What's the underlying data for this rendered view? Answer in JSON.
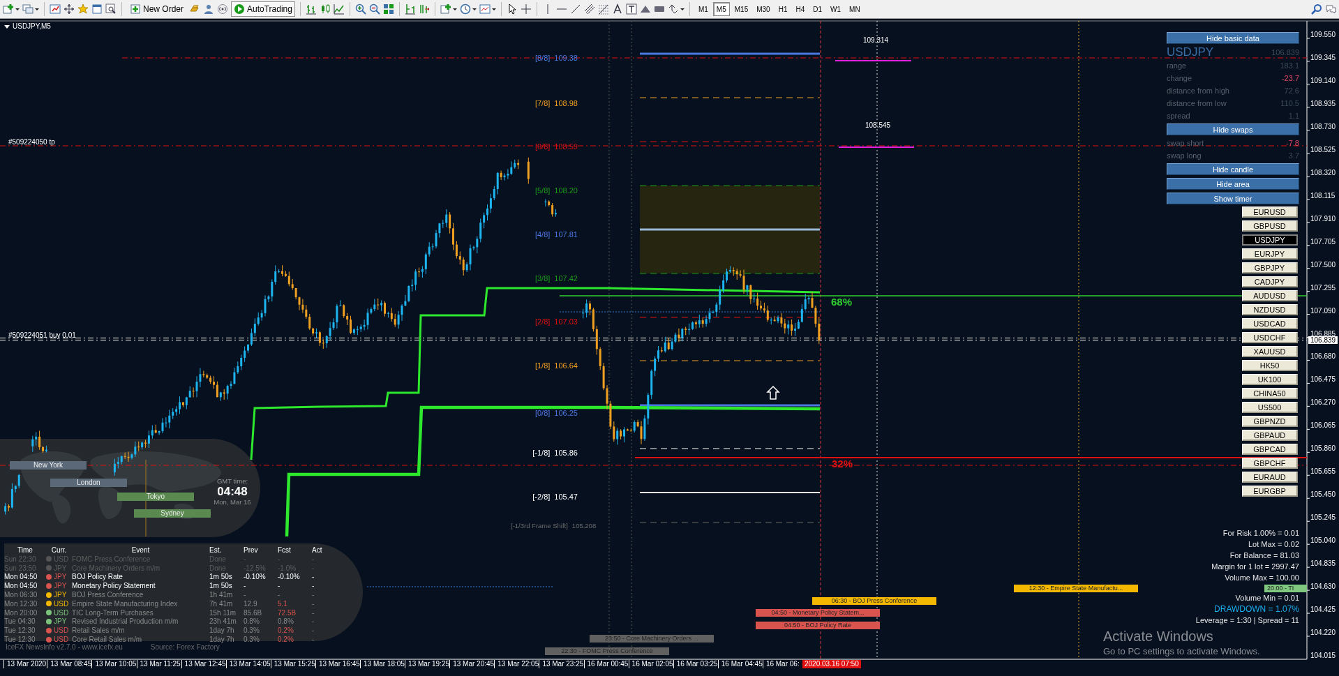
{
  "toolbar": {
    "buttons": [
      "New Order",
      "AutoTrading"
    ],
    "timeframes": [
      {
        "label": "M1",
        "selected": false
      },
      {
        "label": "M5",
        "selected": true
      },
      {
        "label": "M15",
        "selected": false
      },
      {
        "label": "M30",
        "selected": false
      },
      {
        "label": "H1",
        "selected": false
      },
      {
        "label": "H4",
        "selected": false
      },
      {
        "label": "D1",
        "selected": false
      },
      {
        "label": "W1",
        "selected": false
      },
      {
        "label": "MN",
        "selected": false
      }
    ]
  },
  "chart": {
    "title": "USDJPY,M5",
    "order_labels": [
      "#509224050 tp",
      "#509224051 buy 0.01"
    ],
    "murrey_levels": [
      {
        "label": "[8/8]",
        "value": "109.38",
        "color": "#4a78e0"
      },
      {
        "label": "[7/8]",
        "value": "108.98",
        "color": "#f0a020"
      },
      {
        "label": "[6/8]",
        "value": "108.59",
        "color": "#e01010"
      },
      {
        "label": "[5/8]",
        "value": "108.20",
        "color": "#1a9a1a"
      },
      {
        "label": "[4/8]",
        "value": "107.81",
        "color": "#4a78e0"
      },
      {
        "label": "[3/8]",
        "value": "107.42",
        "color": "#1a9a1a"
      },
      {
        "label": "[2/8]",
        "value": "107.03",
        "color": "#e01010"
      },
      {
        "label": "[1/8]",
        "value": "106.64",
        "color": "#f0a020"
      },
      {
        "label": "[0/8]",
        "value": "106.25",
        "color": "#4a78e0"
      },
      {
        "label": "[-1/8]",
        "value": "105.86",
        "color": "#ffffff"
      },
      {
        "label": "[-2/8]",
        "value": "105.47",
        "color": "#ffffff"
      }
    ],
    "frame_shift": {
      "label": "[-1/3rd Frame Shift]",
      "value": "105.208"
    },
    "price_marks": [
      "109.314",
      "108.545"
    ],
    "percent_labels": [
      {
        "text": "68%",
        "color": "#30d030"
      },
      {
        "text": "32%",
        "color": "#e01010"
      }
    ],
    "events": [
      {
        "text": "06:30 - BOJ Press Conference",
        "color": "#f5b800"
      },
      {
        "text": "12:30 - Empire State Manufactu...",
        "color": "#f5b800"
      },
      {
        "text": "04:50 - Monetary Policy Statem...",
        "color": "#d9534f"
      },
      {
        "text": "04:50 - BOJ Policy Rate",
        "color": "#d9534f"
      },
      {
        "text": "23:50 - Core Machinery Orders ...",
        "color": "#606060"
      },
      {
        "text": "22:30 - FOMC Press Conference",
        "color": "#606060"
      },
      {
        "text": "20:00 - TI",
        "color": "#80c880"
      }
    ],
    "price_axis": {
      "ticks": [
        "109.550",
        "109.345",
        "109.140",
        "108.935",
        "108.730",
        "108.525",
        "108.320",
        "108.115",
        "107.910",
        "107.705",
        "107.500",
        "107.295",
        "107.090",
        "106.885",
        "106.680",
        "106.475",
        "106.270",
        "106.065",
        "105.860",
        "105.655",
        "105.450",
        "105.245",
        "105.040",
        "104.835",
        "104.630",
        "104.425",
        "104.220",
        "104.015"
      ],
      "current": "106.839"
    },
    "time_axis": {
      "ticks": [
        "13 Mar 2020",
        "13 Mar 08:45",
        "13 Mar 10:05",
        "13 Mar 11:25",
        "13 Mar 12:45",
        "13 Mar 14:05",
        "13 Mar 15:25",
        "13 Mar 16:45",
        "13 Mar 18:05",
        "13 Mar 19:25",
        "13 Mar 20:45",
        "13 Mar 22:05",
        "13 Mar 23:25",
        "16 Mar 00:45",
        "16 Mar 02:05",
        "16 Mar 03:25",
        "16 Mar 04:45",
        "16 Mar 06:"
      ],
      "current": "2020.03.16 07:50"
    }
  },
  "sessions": {
    "cities": [
      "New York",
      "London",
      "Tokyo",
      "Sydney"
    ],
    "gmt_label": "GMT time:",
    "time": "04:48",
    "date": "Mon, Mar 16"
  },
  "news": {
    "columns": [
      "Time",
      "Curr.",
      "Event",
      "Est.",
      "Prev",
      "Fcst",
      "Act"
    ],
    "rows": [
      {
        "time": "Sun 22:30",
        "currency": "USD",
        "event": "FOMC Press Conference",
        "est": "Done",
        "prev": "-",
        "fcst": "-",
        "act": "-",
        "color": "#555555",
        "done": true,
        "highlighted": false,
        "fcst_lower": false
      },
      {
        "time": "Sun 23:50",
        "currency": "JPY",
        "event": "Core Machinery Orders m/m",
        "est": "Done",
        "prev": "-12.5%",
        "fcst": "-1.0%",
        "act": "-",
        "color": "#555555",
        "done": true,
        "highlighted": false,
        "fcst_lower": false
      },
      {
        "time": "Mon 04:50",
        "currency": "JPY",
        "event": "BOJ Policy Rate",
        "est": "1m 50s",
        "prev": "-0.10%",
        "fcst": "-0.10%",
        "act": "-",
        "color": "#d9534f",
        "done": false,
        "highlighted": true,
        "fcst_lower": false
      },
      {
        "time": "Mon 04:50",
        "currency": "JPY",
        "event": "Monetary Policy Statement",
        "est": "1m 50s",
        "prev": "-",
        "fcst": "-",
        "act": "-",
        "color": "#d9534f",
        "done": false,
        "highlighted": true,
        "fcst_lower": false
      },
      {
        "time": "Mon 06:30",
        "currency": "JPY",
        "event": "BOJ Press Conference",
        "est": "1h 41m",
        "prev": "-",
        "fcst": "-",
        "act": "-",
        "color": "#f5b800",
        "done": false,
        "highlighted": false,
        "fcst_lower": false
      },
      {
        "time": "Mon 12:30",
        "currency": "USD",
        "event": "Empire State Manufacturing Index",
        "est": "7h 41m",
        "prev": "12.9",
        "fcst": "5.1",
        "act": "-",
        "color": "#f5b800",
        "done": false,
        "highlighted": false,
        "fcst_lower": true
      },
      {
        "time": "Mon 20:00",
        "currency": "USD",
        "event": "TIC Long-Term Purchases",
        "est": "15h 11m",
        "prev": "85.6B",
        "fcst": "72.5B",
        "act": "-",
        "color": "#7cc47c",
        "done": false,
        "highlighted": false,
        "fcst_lower": true
      },
      {
        "time": "Tue 04:30",
        "currency": "JPY",
        "event": "Revised Industrial Production m/m",
        "est": "23h 41m",
        "prev": "0.8%",
        "fcst": "0.8%",
        "act": "-",
        "color": "#7cc47c",
        "done": false,
        "highlighted": false,
        "fcst_lower": false
      },
      {
        "time": "Tue 12:30",
        "currency": "USD",
        "event": "Retail Sales m/m",
        "est": "1day 7h",
        "prev": "0.3%",
        "fcst": "0.2%",
        "act": "-",
        "color": "#d9534f",
        "done": false,
        "highlighted": false,
        "fcst_lower": true
      },
      {
        "time": "Tue 12:30",
        "currency": "USD",
        "event": "Core Retail Sales m/m",
        "est": "1day 7h",
        "prev": "0.3%",
        "fcst": "0.2%",
        "act": "-",
        "color": "#d9534f",
        "done": false,
        "highlighted": false,
        "fcst_lower": true
      }
    ],
    "footer": "IceFX NewsInfo v2.7.0  -  www.icefx.eu",
    "source": "Source: Forex Factory"
  },
  "panel": {
    "items": [
      {
        "kind": "button",
        "label": "Hide basic data"
      },
      {
        "kind": "header",
        "symbol": "USDJPY",
        "price": "106.839"
      },
      {
        "kind": "row",
        "label": "range",
        "value": "183.1",
        "negative": false
      },
      {
        "kind": "row",
        "label": "change",
        "value": "-23.7",
        "negative": true
      },
      {
        "kind": "row",
        "label": "distance from high",
        "value": "72.6",
        "negative": false
      },
      {
        "kind": "row",
        "label": "distance from low",
        "value": "110.5",
        "negative": false
      },
      {
        "kind": "row",
        "label": "spread",
        "value": "1.1",
        "negative": false
      },
      {
        "kind": "button",
        "label": "Hide swaps"
      },
      {
        "kind": "row",
        "label": "swap short",
        "value": "-7.8",
        "negative": true
      },
      {
        "kind": "row",
        "label": "swap long",
        "value": "3.7",
        "negative": false
      },
      {
        "kind": "button",
        "label": "Hide candle"
      },
      {
        "kind": "button",
        "label": "Hide area"
      },
      {
        "kind": "button",
        "label": "Show timer"
      }
    ],
    "symbols": [
      {
        "label": "EURUSD",
        "selected": false
      },
      {
        "label": "GBPUSD",
        "selected": false
      },
      {
        "label": "USDJPY",
        "selected": true
      },
      {
        "label": "EURJPY",
        "selected": false
      },
      {
        "label": "GBPJPY",
        "selected": false
      },
      {
        "label": "CADJPY",
        "selected": false
      },
      {
        "label": "AUDUSD",
        "selected": false
      },
      {
        "label": "NZDUSD",
        "selected": false
      },
      {
        "label": "USDCAD",
        "selected": false
      },
      {
        "label": "USDCHF",
        "selected": false
      },
      {
        "label": "XAUUSD",
        "selected": false
      },
      {
        "label": "HK50",
        "selected": false
      },
      {
        "label": "UK100",
        "selected": false
      },
      {
        "label": "CHINA50",
        "selected": false
      },
      {
        "label": "US500",
        "selected": false
      },
      {
        "label": "GBPNZD",
        "selected": false
      },
      {
        "label": "GBPAUD",
        "selected": false
      },
      {
        "label": "GBPCAD",
        "selected": false
      },
      {
        "label": "GBPCHF",
        "selected": false
      },
      {
        "label": "EURAUD",
        "selected": false
      },
      {
        "label": "EURGBP",
        "selected": false
      }
    ]
  },
  "risk": [
    {
      "text": "For Risk 1.00% = 0.01",
      "kind": "info"
    },
    {
      "text": "Lot Max = 0.02",
      "kind": "info"
    },
    {
      "text": "For Balance = 81.03",
      "kind": "info"
    },
    {
      "text": "Margin for 1 lot = 2997.47",
      "kind": "info"
    },
    {
      "text": "Volume Max = 100.00",
      "kind": "info"
    },
    {
      "text": "Volume Min = 0.01",
      "kind": "info"
    },
    {
      "text": "DRAWDOWN =  1.07%",
      "kind": "drawdown"
    },
    {
      "text": "Leverage = 1:30 | Spread = 11",
      "kind": "info"
    }
  ],
  "os_notice": {
    "title": "Activate Windows",
    "text": "Go to PC settings to activate Windows."
  }
}
